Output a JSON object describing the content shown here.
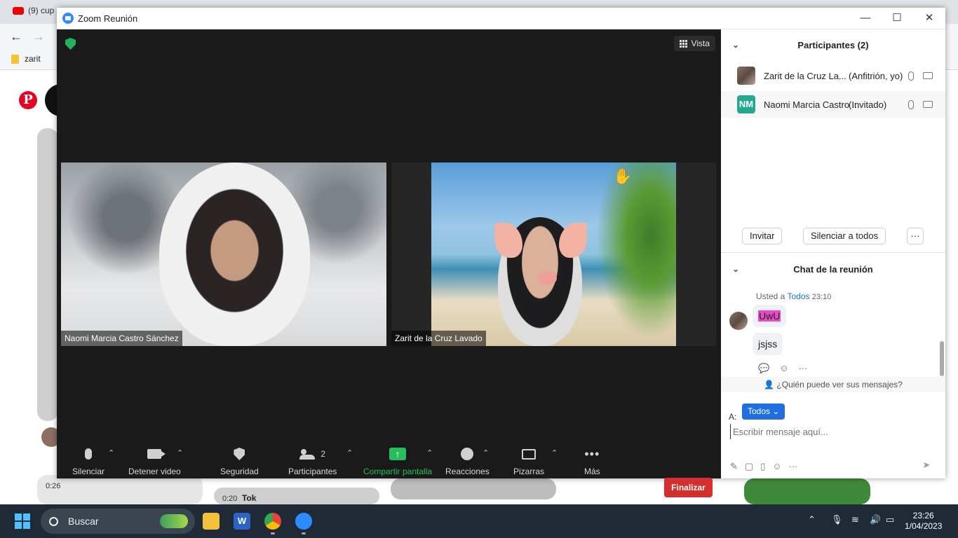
{
  "browser": {
    "tab_title": "(9) cup",
    "bookmark": "zarit"
  },
  "pinterest": {
    "logo": "P",
    "duration_1": "0:26",
    "duration_2": "0:20",
    "tiktok_label": "Tok"
  },
  "zoom": {
    "window_title": "Zoom Reunión",
    "view_label": "Vista",
    "tiles": [
      {
        "name": "Naomi Marcia Castro Sánchez"
      },
      {
        "name": "Zarit de la Cruz Lavado"
      }
    ],
    "toolbar": {
      "mute": "Silenciar",
      "stop_video": "Detener video",
      "security": "Seguridad",
      "participants": "Participantes",
      "participants_count": "2",
      "share": "Compartir pantalla",
      "reactions": "Reacciones",
      "whiteboards": "Pizarras",
      "more": "Más",
      "end": "Finalizar"
    }
  },
  "panel": {
    "participants_header": "Participantes (2)",
    "participants": [
      {
        "name": "Zarit de la Cruz La...",
        "role": "(Anfitrión, yo)",
        "initials": ""
      },
      {
        "name": "Naomi Marcia Castro ...",
        "role": "(Invitado)",
        "initials": "NM"
      }
    ],
    "invite": "Invitar",
    "mute_all": "Silenciar a todos",
    "more": "···",
    "chat_header": "Chat de la reunión",
    "chat_meta_prefix": "Usted a",
    "chat_meta_to": "Todos",
    "chat_meta_time": "23:10",
    "messages": [
      "UwU",
      "jsjss"
    ],
    "who_can_see": "¿Quién puede ver sus mensajes?",
    "to_label": "A:",
    "to_value": "Todos",
    "input_placeholder": "Escribir mensaje aquí..."
  },
  "taskbar": {
    "search_label": "Buscar",
    "time": "23:26",
    "date": "1/04/2023"
  }
}
